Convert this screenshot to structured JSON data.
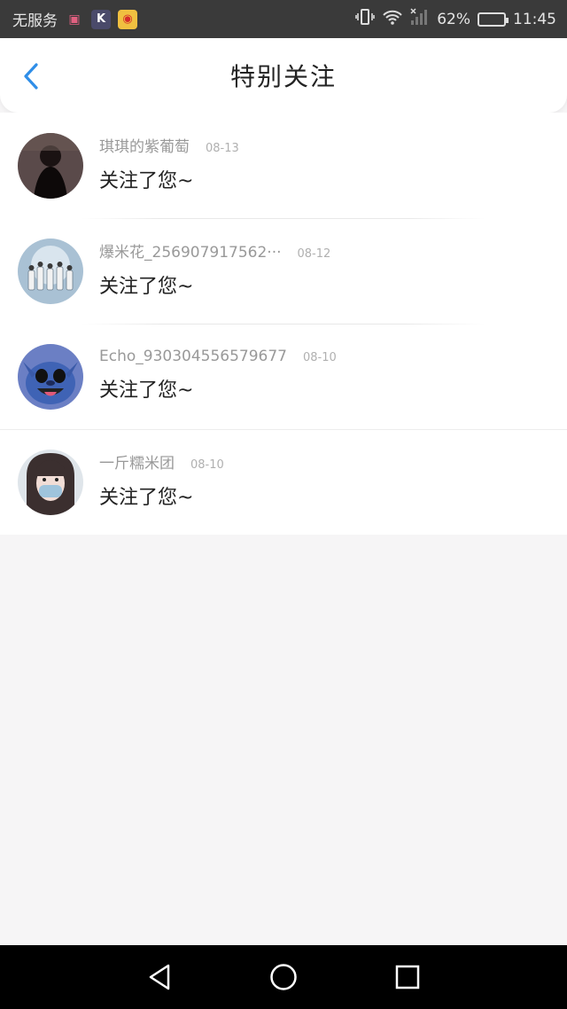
{
  "status_bar": {
    "carrier": "无服务",
    "battery_percent": "62%",
    "battery_level": 0.62,
    "time": "11:45",
    "app_icons": [
      "shopping-bag-icon",
      "k-app-icon",
      "weibo-icon"
    ]
  },
  "header": {
    "title": "特别关注"
  },
  "list": [
    {
      "name": "琪琪的紫葡萄",
      "date": "08-13",
      "message": "关注了您~",
      "avatar_color": "#222222"
    },
    {
      "name": "爆米花_256907917562···",
      "date": "08-12",
      "message": "关注了您~",
      "avatar_color": "#9fb7c9"
    },
    {
      "name": "Echo_9303045565796​77",
      "date": "08-10",
      "message": "关注了您~",
      "avatar_color": "#4a6fb0"
    },
    {
      "name": "一斤糯米团",
      "date": "08-10",
      "message": "关注了您~",
      "avatar_color": "#b9c3cc"
    }
  ],
  "colors": {
    "accent": "#2f8ee8",
    "background": "#f6f5f6"
  }
}
